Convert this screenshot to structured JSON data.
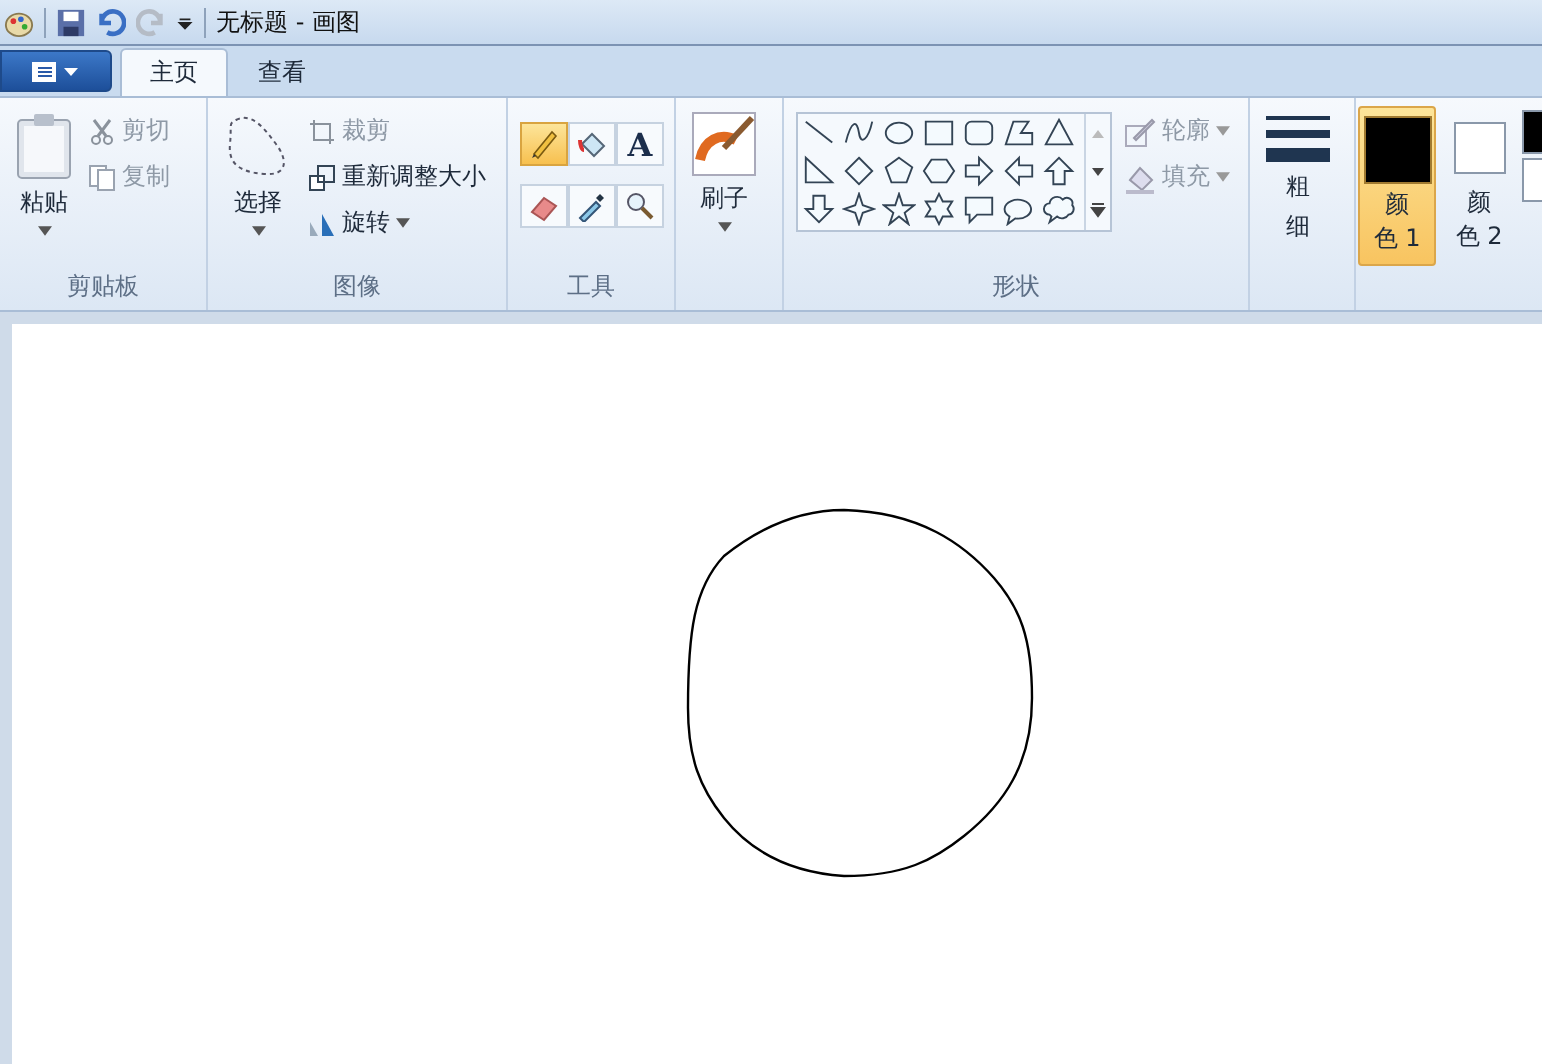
{
  "title_bar": {
    "title": "无标题 - 画图"
  },
  "tabs": [
    {
      "label": "主页",
      "selected": true
    },
    {
      "label": "查看",
      "selected": false
    }
  ],
  "clipboard": {
    "paste": "粘贴",
    "cut": {
      "label": "剪切",
      "disabled": true
    },
    "copy": {
      "label": "复制",
      "disabled": true
    },
    "group_label": "剪贴板"
  },
  "image": {
    "select": "选择",
    "crop": {
      "label": "裁剪",
      "disabled": true
    },
    "resize": {
      "label": "重新调整大小",
      "disabled": false
    },
    "rotate": {
      "label": "旋转",
      "disabled": false
    },
    "group_label": "图像"
  },
  "tools": {
    "items": [
      {
        "kind": "pencil",
        "selected": true
      },
      {
        "kind": "fill",
        "selected": false
      },
      {
        "kind": "text",
        "label": "A",
        "selected": false
      },
      {
        "kind": "eraser",
        "selected": false
      },
      {
        "kind": "picker",
        "selected": false
      },
      {
        "kind": "magnifier",
        "selected": false
      }
    ],
    "group_label": "工具"
  },
  "brushes": {
    "label": "刷子"
  },
  "shapes": {
    "outline": {
      "label": "轮廓",
      "disabled": true
    },
    "fill": {
      "label": "填充",
      "disabled": true
    },
    "group_label": "形状"
  },
  "size": {
    "label_lines": [
      "粗",
      "细"
    ]
  },
  "colors": [
    {
      "lines": [
        "颜",
        "色 1"
      ],
      "color": "#000000",
      "selected": true
    },
    {
      "lines": [
        "颜",
        "色 2"
      ],
      "color": "#ffffff",
      "selected": false
    }
  ],
  "palette": [
    {
      "color": "#000000"
    },
    {
      "color": "#ffffff"
    }
  ]
}
